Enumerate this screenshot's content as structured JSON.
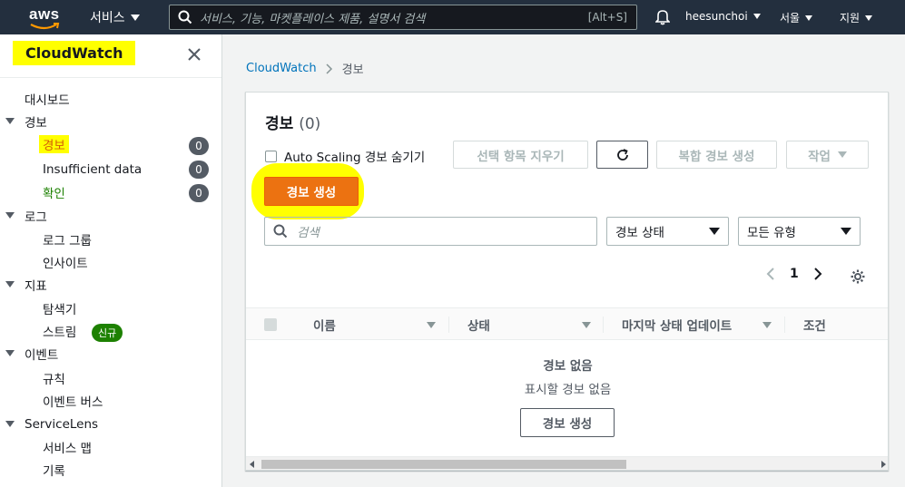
{
  "topnav": {
    "logo_text": "aws",
    "services_label": "서비스",
    "search_placeholder": "서비스, 기능, 마켓플레이스 제품, 설명서 검색",
    "search_shortcut": "[Alt+S]",
    "user_label": "heesunchoi",
    "region_label": "서울",
    "support_label": "지원"
  },
  "sidebar": {
    "title": "CloudWatch",
    "items": {
      "dashboard": "대시보드",
      "alarms_group": "경보",
      "alarms": "경보",
      "insufficient": "Insufficient data",
      "ok": "확인",
      "logs_group": "로그",
      "log_groups": "로그 그룹",
      "insights": "인사이트",
      "metrics_group": "지표",
      "explorer": "탐색기",
      "streams": "스트림",
      "streams_badge": "신규",
      "events_group": "이벤트",
      "rules": "규칙",
      "event_bus": "이벤트 버스",
      "servicelens_group": "ServiceLens",
      "service_map": "서비스 맵",
      "traces": "기록"
    },
    "counts": {
      "alarms": "0",
      "insufficient": "0",
      "ok": "0"
    }
  },
  "breadcrumb": {
    "root": "CloudWatch",
    "current": "경보"
  },
  "panel": {
    "title": "경보",
    "count": "(0)",
    "hide_autoscaling_label": "Auto Scaling 경보 숨기기",
    "clear_selection_label": "선택 항목 지우기",
    "composite_label": "복합 경보 생성",
    "actions_label": "작업",
    "create_alarm_label": "경보 생성",
    "filter_placeholder": "검색",
    "state_select": "경보 상태",
    "type_select": "모든 유형",
    "page_number": "1",
    "columns": {
      "name": "이름",
      "state": "상태",
      "last_update": "마지막 상태 업데이트",
      "conditions": "조건"
    },
    "empty_title": "경보 없음",
    "empty_subtitle": "표시할 경보 없음",
    "empty_create_label": "경보 생성"
  }
}
